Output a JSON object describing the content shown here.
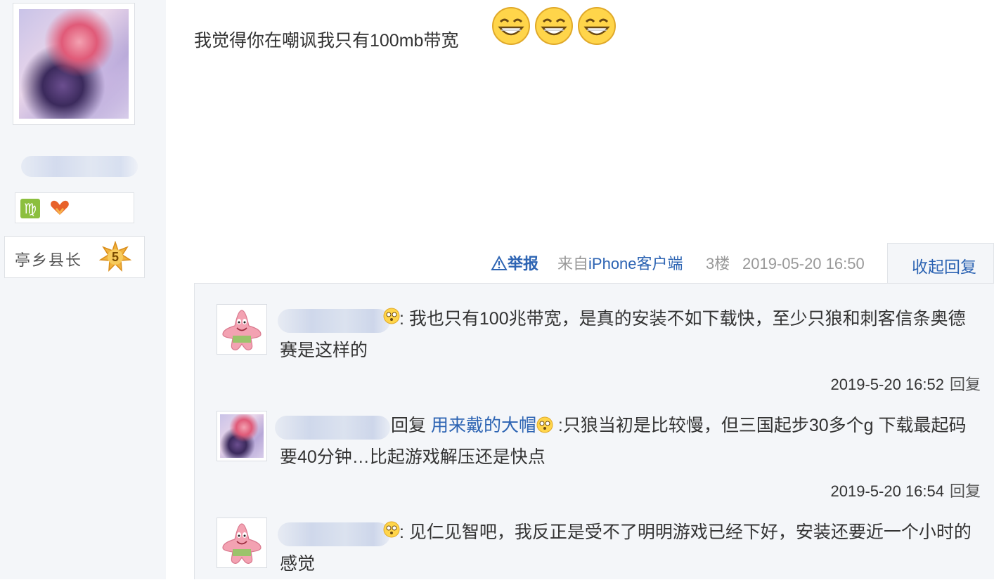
{
  "sidebar": {
    "level_title": "亭乡县长",
    "level_number": "5",
    "zodiac_symbol": "♍",
    "zodiac_icon": "virgo-icon",
    "heart_icon": "heart-hands-icon",
    "accent_colors": {
      "zodiac": "#8cbf3f",
      "heart": "#e8622a",
      "badge": "#f2b33d"
    }
  },
  "post": {
    "text": "我觉得你在嘲讽我只有100mb带宽",
    "emojis": [
      "grin-emoji",
      "grin-emoji",
      "grin-emoji"
    ]
  },
  "post_meta": {
    "report_label": "举报",
    "source_prefix": "来自",
    "source_link": "iPhone客户端",
    "floor": "3楼",
    "date": "2019-05-20 16:50",
    "collapse_label": "收起回复"
  },
  "replies": [
    {
      "text": ": 我也只有100兆带宽，是真的安装不如下载快，至少只狼和刺客信条奥德赛是这样的",
      "time": "2019-5-20 16:52",
      "reply_label": "回复"
    },
    {
      "reply_prefix": "回复 ",
      "reply_to": "用来戴的大帽",
      "text": " :只狼当初是比较慢，但三国起步30多个g 下载最起码要40分钟…比起游戏解压还是快点",
      "time": "2019-5-20 16:54",
      "reply_label": "回复"
    },
    {
      "text": ": 见仁见智吧，我反正是受不了明明游戏已经下好，安装还要近一个小时的感觉"
    }
  ],
  "colors": {
    "link": "#2d64b3",
    "panel_bg": "#f4f6f9",
    "meta_gray": "#999999"
  }
}
